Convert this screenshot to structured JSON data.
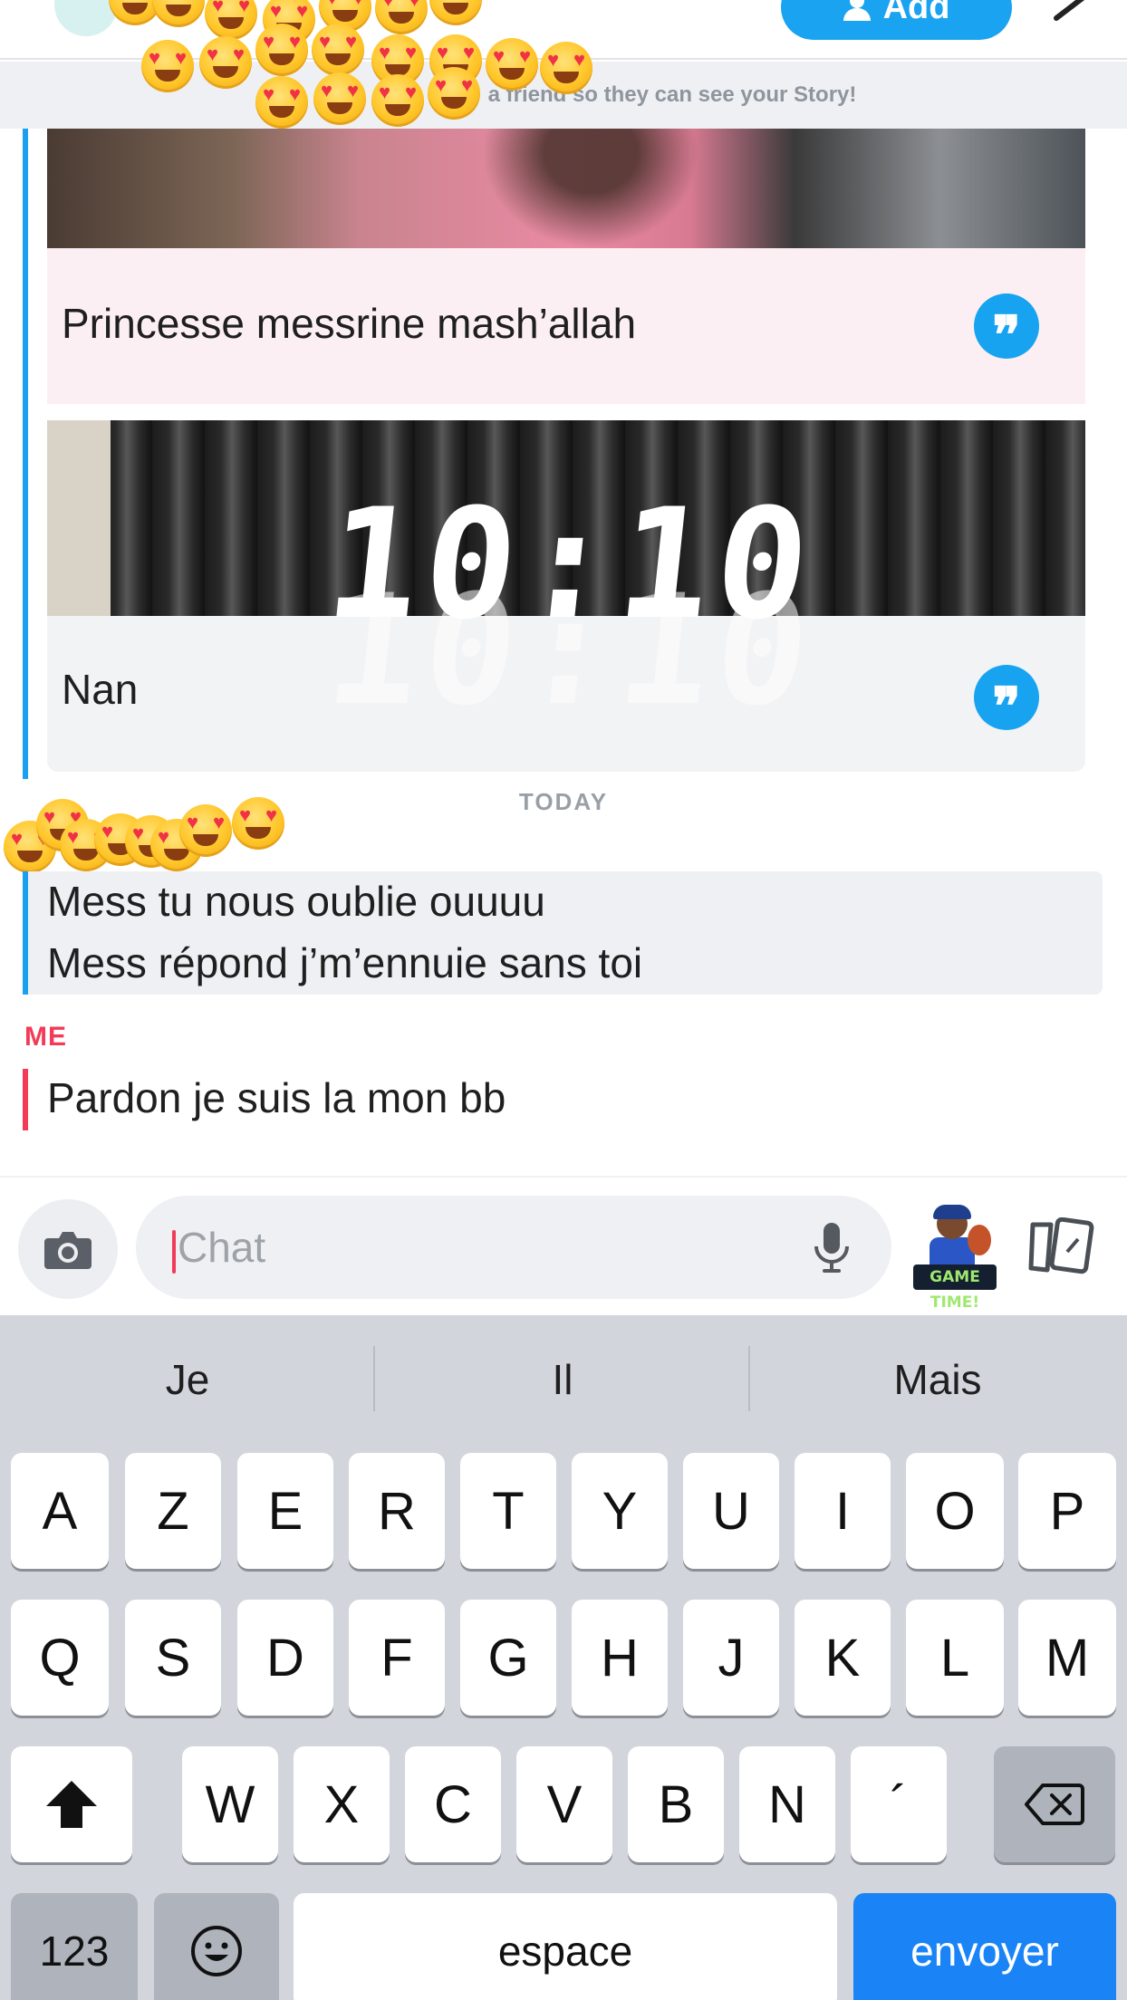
{
  "header": {
    "add_label": "Add",
    "banner_text": "a friend so they can see your Story!"
  },
  "story_replies": [
    {
      "text": "Princesse messrine mash’allah",
      "clock": ""
    },
    {
      "text": "Nan",
      "clock": "10:10"
    }
  ],
  "conversation": {
    "day_label": "TODAY",
    "friend_lines": [
      "Mess tu nous oublie ouuuu",
      "Mess répond j’m’ennuie sans toi"
    ],
    "me_label": "ME",
    "me_message": "Pardon je suis la mon bb"
  },
  "chat_bar": {
    "placeholder": "Chat",
    "bitmoji_tag": "GAME TIME!"
  },
  "keyboard": {
    "suggestions": [
      "Je",
      "Il",
      "Mais"
    ],
    "row1": [
      "A",
      "Z",
      "E",
      "R",
      "T",
      "Y",
      "U",
      "I",
      "O",
      "P"
    ],
    "row2": [
      "Q",
      "S",
      "D",
      "F",
      "G",
      "H",
      "J",
      "K",
      "L",
      "M"
    ],
    "row3": [
      "W",
      "X",
      "C",
      "V",
      "B",
      "N",
      "´"
    ],
    "numbers_label": "123",
    "space_label": "espace",
    "send_label": "envoyer"
  },
  "colors": {
    "accent_blue": "#1aa0ef",
    "me_red": "#f23c57",
    "keyboard_bg": "#d2d5db"
  },
  "icons": [
    "camera-icon",
    "microphone-icon",
    "cards-icon",
    "quote-icon",
    "shift-icon",
    "backspace-icon",
    "emoji-icon",
    "heart-eyes-emoji"
  ]
}
